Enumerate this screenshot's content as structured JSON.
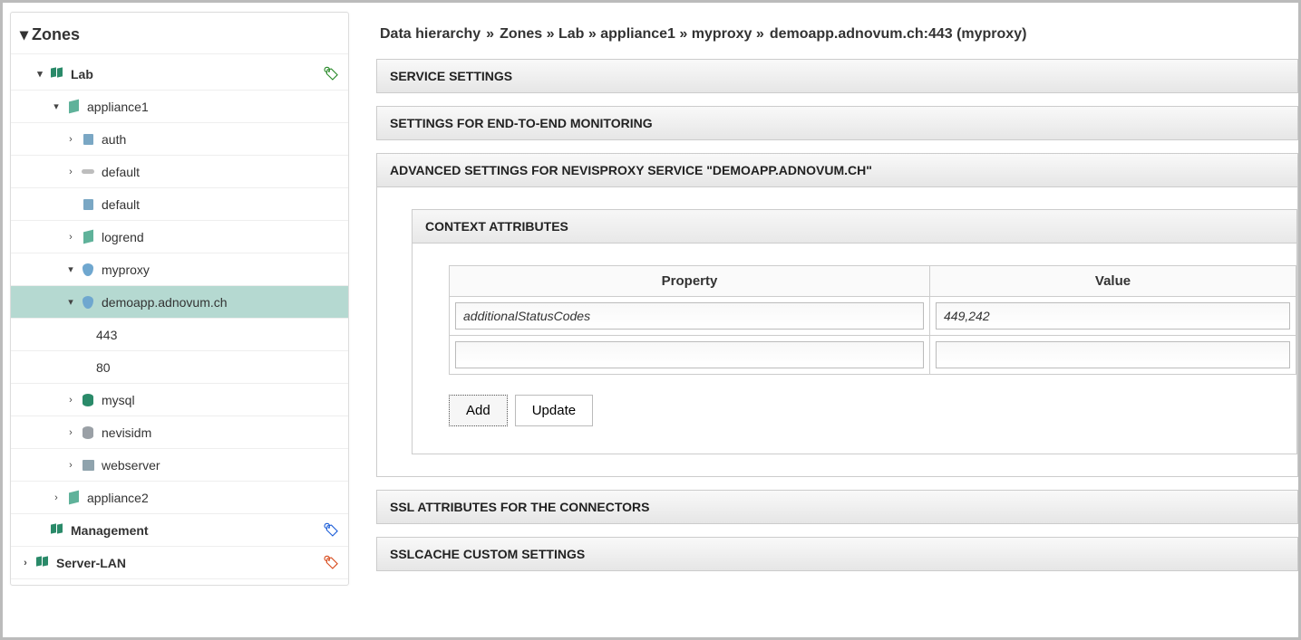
{
  "sidebar": {
    "title": "Zones",
    "items": [
      {
        "depth": 1,
        "expand": "open",
        "icon": "cubes",
        "label": "Lab",
        "tag": "green",
        "top": true
      },
      {
        "depth": 2,
        "expand": "open",
        "icon": "cube",
        "label": "appliance1"
      },
      {
        "depth": 3,
        "expand": "closed",
        "icon": "lock",
        "label": "auth"
      },
      {
        "depth": 3,
        "expand": "closed",
        "icon": "key",
        "label": "default"
      },
      {
        "depth": 4,
        "expand": "none",
        "icon": "lock",
        "label": "default"
      },
      {
        "depth": 3,
        "expand": "closed",
        "icon": "cube",
        "label": "logrend"
      },
      {
        "depth": 3,
        "expand": "open",
        "icon": "shield",
        "label": "myproxy"
      },
      {
        "depth": 4,
        "expand": "open",
        "icon": "shield",
        "label": "demoapp.adnovum.ch",
        "selected": true
      },
      {
        "depth": 6,
        "expand": "none",
        "icon": "",
        "label": "443"
      },
      {
        "depth": 6,
        "expand": "none",
        "icon": "",
        "label": "80"
      },
      {
        "depth": 3,
        "expand": "closed",
        "icon": "db",
        "label": "mysql"
      },
      {
        "depth": 3,
        "expand": "closed",
        "icon": "dbgrey",
        "label": "nevisidm"
      },
      {
        "depth": 3,
        "expand": "closed",
        "icon": "srv",
        "label": "webserver"
      },
      {
        "depth": 2,
        "expand": "closed",
        "icon": "cube",
        "label": "appliance2"
      },
      {
        "depth": 1,
        "expand": "none",
        "icon": "cubes",
        "label": "Management",
        "tag": "blue",
        "top": true
      },
      {
        "depth": 0,
        "expand": "closed",
        "icon": "cubes",
        "label": "Server-LAN",
        "tag": "red",
        "top": true
      }
    ]
  },
  "breadcrumb": {
    "root": "Data hierarchy",
    "path": [
      "Zones",
      "Lab",
      "appliance1",
      "myproxy"
    ],
    "current": "demoapp.adnovum.ch:443 (myproxy)"
  },
  "panels": {
    "service_settings": "Service Settings",
    "e2e_monitoring": "Settings for End-to-End Monitoring",
    "advanced": "Advanced settings for nevisProxy service \"demoapp.adnovum.ch\"",
    "ssl_connectors": "SSL attributes for the connectors",
    "sslcache": "SSLCache custom settings"
  },
  "context_attributes": {
    "title": "Context attributes",
    "columns": {
      "property": "Property",
      "value": "Value"
    },
    "rows": [
      {
        "property": "additionalStatusCodes",
        "value": "449,242"
      },
      {
        "property": "",
        "value": ""
      }
    ],
    "buttons": {
      "add": "Add",
      "update": "Update"
    }
  }
}
